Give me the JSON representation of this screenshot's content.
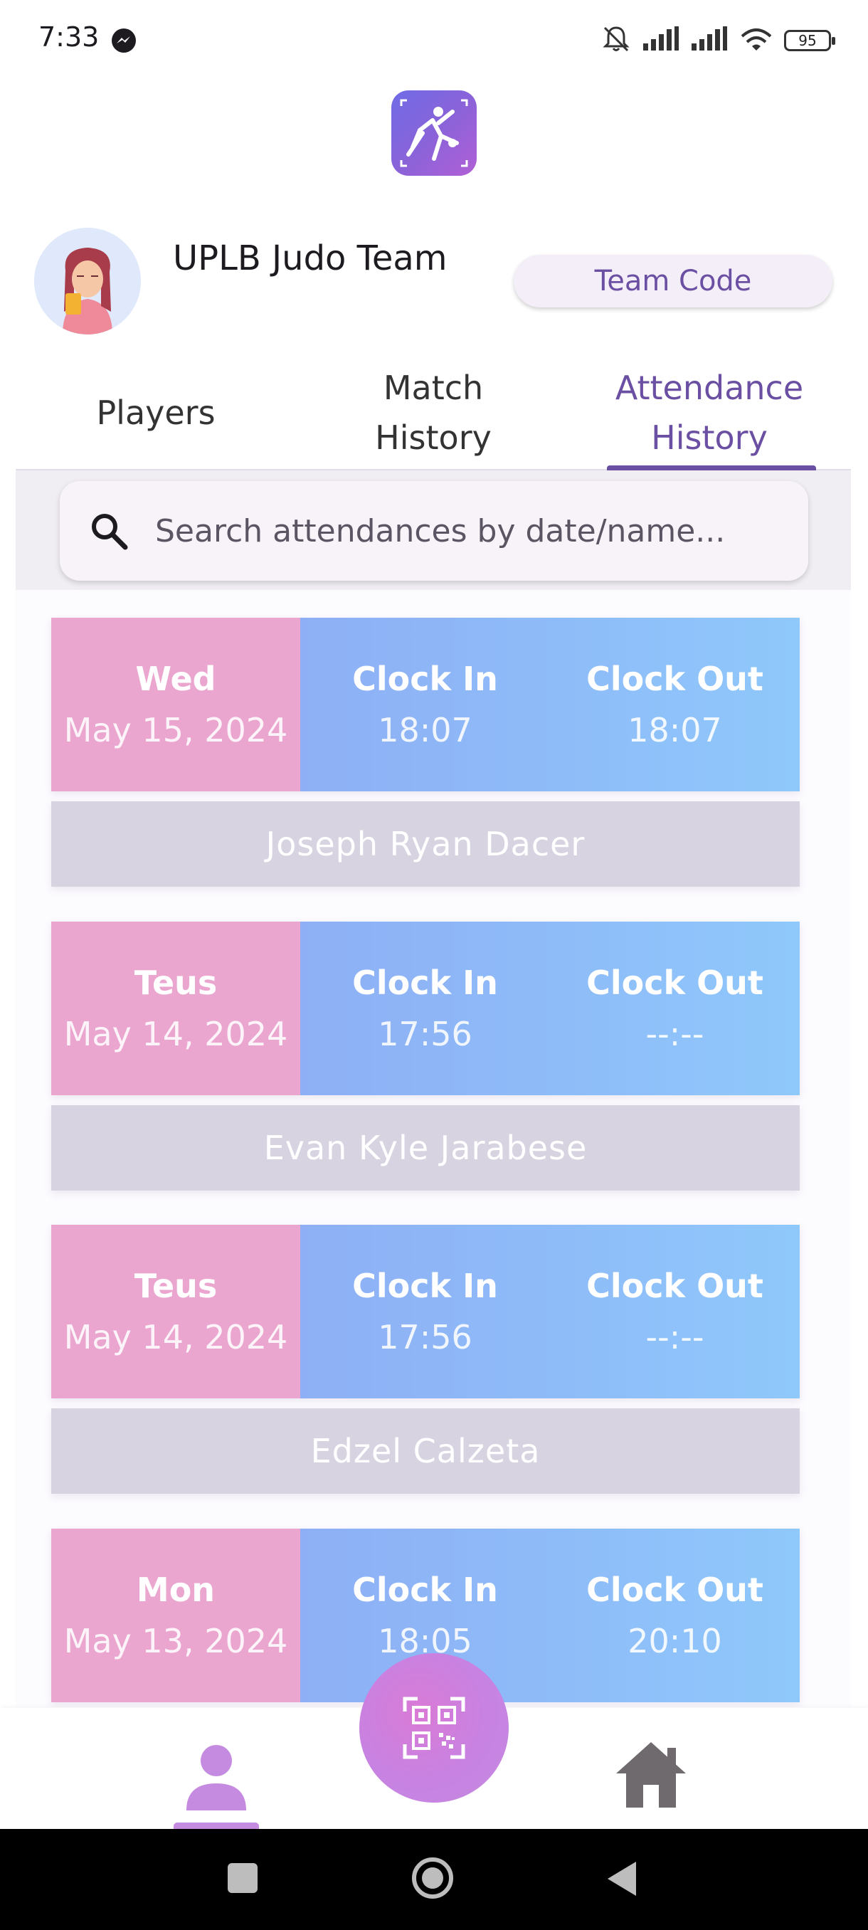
{
  "status_bar": {
    "time": "7:33",
    "battery": "95"
  },
  "team": {
    "name": "UPLB Judo Team",
    "team_code_label": "Team Code"
  },
  "tabs": [
    {
      "label": "Players"
    },
    {
      "label": "Match\nHistory"
    },
    {
      "label": "Attendance\nHistory",
      "active": true
    }
  ],
  "search": {
    "placeholder": "Search attendances by date/name..."
  },
  "attendance": [
    {
      "day": "Wed",
      "date": "May 15, 2024",
      "clock_in_label": "Clock In",
      "clock_in": "18:07",
      "clock_out_label": "Clock Out",
      "clock_out": "18:07",
      "name": "Joseph Ryan Dacer"
    },
    {
      "day": "Teus",
      "date": "May 14, 2024",
      "clock_in_label": "Clock In",
      "clock_in": "17:56",
      "clock_out_label": "Clock Out",
      "clock_out": "--:--",
      "name": "Evan Kyle Jarabese"
    },
    {
      "day": "Teus",
      "date": "May 14, 2024",
      "clock_in_label": "Clock In",
      "clock_in": "17:56",
      "clock_out_label": "Clock Out",
      "clock_out": "--:--",
      "name": "Edzel Calzeta"
    },
    {
      "day": "Mon",
      "date": "May 13, 2024",
      "clock_in_label": "Clock In",
      "clock_in": "18:05",
      "clock_out_label": "Clock Out",
      "clock_out": "20:10",
      "name": ""
    }
  ],
  "colors": {
    "accent": "#6a4fa3",
    "date_cell": "#eba6d0",
    "time_gradient_start": "#8eaff5",
    "time_gradient_end": "#8fc8fb",
    "name_bar": "#d7d3e1",
    "fab": "#c782e2"
  },
  "icons": {
    "app_logo": "judo-logo-icon",
    "search": "search-icon",
    "profile_nav": "person-icon",
    "qr_fab": "qr-code-icon",
    "home_nav": "home-icon"
  }
}
